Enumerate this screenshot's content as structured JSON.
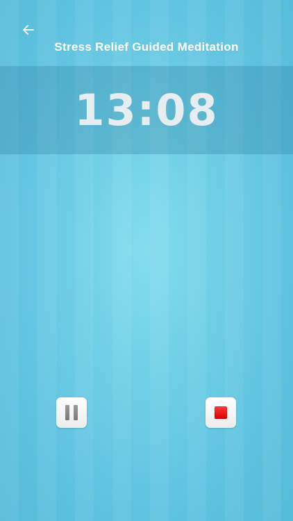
{
  "header": {
    "title": "Stress Relief Guided Meditation",
    "back_icon": "arrow-left-icon"
  },
  "timer": {
    "display": "13:08"
  },
  "controls": {
    "pause_icon": "pause-icon",
    "stop_icon": "stop-icon"
  },
  "colors": {
    "background": "#6fcfe6",
    "timer_band": "#4fa6bf",
    "stop": "#e00000"
  }
}
